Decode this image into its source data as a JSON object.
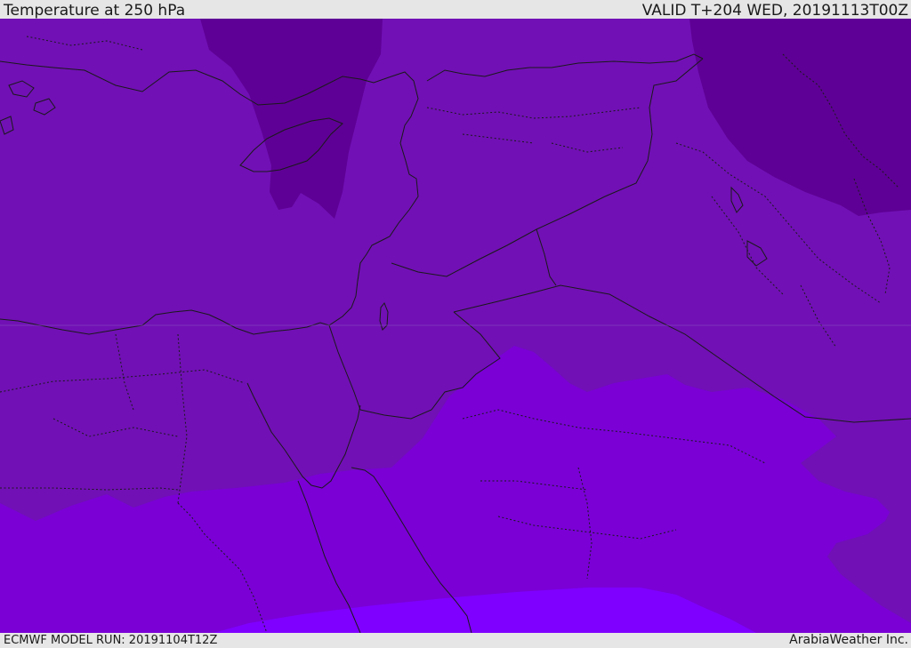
{
  "header": {
    "title": "Temperature at 250 hPa",
    "valid": "VALID T+204 WED, 20191113T00Z"
  },
  "footer": {
    "model_run": "ECMWF MODEL RUN: 20191104T12Z",
    "credit": "ArabiaWeather Inc."
  },
  "map": {
    "fill_colors": {
      "coldest": "#5e0095",
      "cold": "#7110b5",
      "mid": "#7a00d6",
      "warm": "#7f00ff"
    },
    "border_color": "#1a1a1a"
  }
}
